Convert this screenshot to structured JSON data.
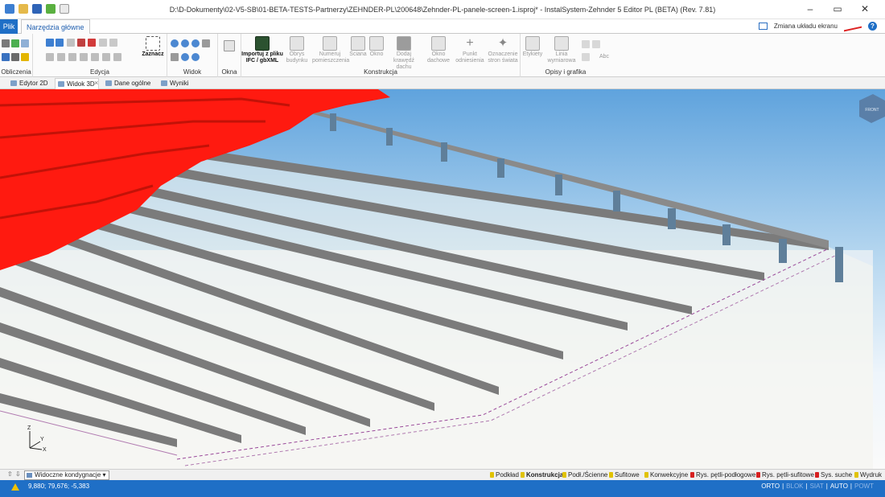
{
  "window": {
    "title": "D:\\D-Dokumenty\\02-V5-SB\\01-BETA-TESTS-Partnerzy\\ZEHNDER-PL\\200648\\Zehnder-PL-panele-screen-1.isproj* - InstalSystem-Zehnder 5 Editor PL (BETA) (Rev. 7.81)",
    "controls": [
      "–",
      "▭",
      "✕"
    ]
  },
  "ribbon_tabs": {
    "file": "Plik",
    "home": "Narzędzia główne",
    "screen_layout": "Zmiana układu ekranu",
    "help": "?"
  },
  "groups": {
    "obliczenia": "Obliczenia",
    "edycja": "Edycja",
    "widok": "Widok",
    "okna": "Okna",
    "konstrukcja": "Konstrukcja",
    "opisy": "Opisy i grafika"
  },
  "buttons": {
    "select": "Zaznacz",
    "import_ifc": "Importuj z pliku IFC / gbXML",
    "building_outline": "Obrys budynku",
    "room_numbering": "Numeruj pomieszczenia",
    "wall": "Ściana",
    "window": "Okno",
    "roof_edge": "Dodaj krawędź dachu",
    "roof_window": "Okno dachowe",
    "reference_point": "Punkt odniesienia",
    "compass": "Oznaczenie stron świata",
    "labels": "Etykiety",
    "dimension_line": "Linia wymiarowa",
    "abc": "Abc"
  },
  "doc_tabs": [
    "Edytor 2D",
    "Widok 3D",
    "Dane ogólne",
    "Wyniki"
  ],
  "viewcube": {
    "label": "FRONT"
  },
  "axes": {
    "z": "Z",
    "y": "Y",
    "x": "X"
  },
  "layer_bar": {
    "selector": "Widoczne kondygnacje",
    "layers": [
      "Podkład",
      "Konstrukcja",
      "Podł./Ścienne",
      "Sufitowe",
      "Konwekcyjne",
      "Rys. pętli-podłogowe",
      "Rys. pętli-sufitowe",
      "Sys. suche",
      "Wydruk"
    ],
    "active": "Konstrukcja"
  },
  "status": {
    "coordinates": "9,880; 79,676; -5,383",
    "modes": [
      {
        "label": "ORTO",
        "on": true
      },
      {
        "label": "BLOK",
        "on": false
      },
      {
        "label": "SIAT",
        "on": false
      },
      {
        "label": "AUTO",
        "on": true
      },
      {
        "label": "POWT",
        "on": false
      }
    ]
  },
  "colors": {
    "accent": "#1f6fc6",
    "panel_red": "#ff1a10",
    "beam_gray": "#7b7b7b",
    "sky_top": "#5fa3dd"
  }
}
